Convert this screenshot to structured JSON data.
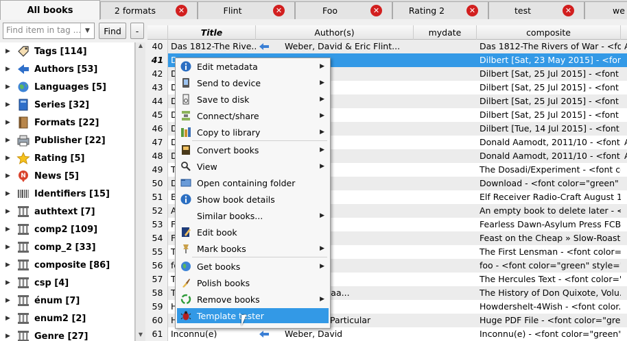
{
  "tabs": [
    {
      "label": "All books",
      "active": true,
      "closable": false
    },
    {
      "label": "2 formats",
      "active": false,
      "closable": true
    },
    {
      "label": "Flint",
      "active": false,
      "closable": true
    },
    {
      "label": "Foo",
      "active": false,
      "closable": true
    },
    {
      "label": "Rating 2",
      "active": false,
      "closable": true
    },
    {
      "label": "test",
      "active": false,
      "closable": true
    },
    {
      "label": "we",
      "active": false,
      "closable": false
    }
  ],
  "close_glyph": "✕",
  "search": {
    "placeholder": "Find item in tag ...",
    "find_label": "Find",
    "minus_label": "-"
  },
  "tree": [
    {
      "label": "Tags [114]",
      "icon": "tag-icon"
    },
    {
      "label": "Authors [53]",
      "icon": "author-arrow-icon"
    },
    {
      "label": "Languages [5]",
      "icon": "globe-icon"
    },
    {
      "label": "Series [32]",
      "icon": "series-icon"
    },
    {
      "label": "Formats [22]",
      "icon": "book-icon"
    },
    {
      "label": "Publisher [22]",
      "icon": "publisher-icon"
    },
    {
      "label": "Rating [5]",
      "icon": "star-icon"
    },
    {
      "label": "News [5]",
      "icon": "news-icon"
    },
    {
      "label": "Identifiers [15]",
      "icon": "barcode-icon"
    },
    {
      "label": "authtext [7]",
      "icon": "column-icon"
    },
    {
      "label": "comp2 [109]",
      "icon": "column-icon"
    },
    {
      "label": "comp_2 [33]",
      "icon": "column-icon"
    },
    {
      "label": "composite [86]",
      "icon": "column-icon"
    },
    {
      "label": "csp [4]",
      "icon": "column-icon"
    },
    {
      "label": "énum [7]",
      "icon": "column-icon"
    },
    {
      "label": "enum2 [2]",
      "icon": "column-icon"
    },
    {
      "label": "Genre [27]",
      "icon": "column-icon"
    }
  ],
  "columns": {
    "title": "Title",
    "authors": "Author(s)",
    "mydate": "mydate",
    "composite": "composite"
  },
  "rows": [
    {
      "num": "40",
      "title": "Das 1812-The Rive...",
      "arrow": true,
      "author": "Weber, David & Eric Flint...",
      "composite": "Das 1812-The Rivers of War - <font..",
      "extra": "A",
      "selected": false
    },
    {
      "num": "41",
      "title": "D",
      "arrow": false,
      "author": "",
      "composite": "Dilbert [Sat, 23 May 2015] - <font c...",
      "extra": "",
      "selected": true
    },
    {
      "num": "42",
      "title": "D",
      "arrow": false,
      "author": "",
      "composite": "Dilbert [Sat, 25 Jul 2015] - <font c...",
      "extra": "",
      "selected": false
    },
    {
      "num": "43",
      "title": "D",
      "arrow": false,
      "author": "",
      "composite": "Dilbert [Sat, 25 Jul 2015] - <font c...",
      "extra": "",
      "selected": false
    },
    {
      "num": "44",
      "title": "D",
      "arrow": false,
      "author": "",
      "composite": "Dilbert [Sat, 25 Jul 2015] - <font c...",
      "extra": "",
      "selected": false
    },
    {
      "num": "45",
      "title": "D",
      "arrow": false,
      "author": "",
      "composite": "Dilbert [Sat, 25 Jul 2015] - <font c...",
      "extra": "",
      "selected": false
    },
    {
      "num": "46",
      "title": "D",
      "arrow": false,
      "author": "",
      "composite": "Dilbert [Tue, 14 Jul 2015] - <font ...",
      "extra": "",
      "selected": false
    },
    {
      "num": "47",
      "title": "D",
      "arrow": false,
      "author": "MacArthur",
      "composite": "Donald Aamodt, 2011/10 - <font c...",
      "extra": "A",
      "selected": false
    },
    {
      "num": "48",
      "title": "D",
      "arrow": false,
      "author": "gh",
      "composite": "Donald Aamodt, 2011/10 - <font c...",
      "extra": "A",
      "selected": false
    },
    {
      "num": "49",
      "title": "T",
      "arrow": false,
      "author": "ert",
      "composite": "The Dosadi/Experiment - <font co...",
      "extra": "",
      "selected": false
    },
    {
      "num": "50",
      "title": "D",
      "arrow": false,
      "author": "",
      "composite": "Download - <font color=\"green\" s...",
      "extra": "",
      "selected": false
    },
    {
      "num": "51",
      "title": "E",
      "arrow": false,
      "author": "",
      "composite": "Elf Receiver Radio-Craft August 1...",
      "extra": "",
      "selected": false
    },
    {
      "num": "52",
      "title": "A",
      "arrow": false,
      "author": "or",
      "composite": "An empty book to delete later - <...",
      "extra": "",
      "selected": false
    },
    {
      "num": "53",
      "title": "F",
      "arrow": false,
      "author": "",
      "composite": "Fearless Dawn-Asylum Press FCB...",
      "extra": "",
      "selected": false
    },
    {
      "num": "54",
      "title": "F",
      "arrow": false,
      "author": "",
      "composite": "Feast on the Cheap » Slow-Roast...",
      "extra": "",
      "selected": false
    },
    {
      "num": "55",
      "title": "T",
      "arrow": false,
      "author": "r",
      "composite": "The First Lensman - <font color=...",
      "extra": "",
      "selected": false
    },
    {
      "num": "56",
      "title": "fo",
      "arrow": false,
      "author": "",
      "composite": "foo - <font color=\"green\" style=\"f...",
      "extra": "",
      "selected": false
    },
    {
      "num": "57",
      "title": "T",
      "arrow": false,
      "author": "tt",
      "composite": "The Hercules Text - <font color=\"...",
      "extra": "",
      "selected": false
    },
    {
      "num": "58",
      "title": "T",
      "arrow": false,
      "author": "ervantes Raa...",
      "composite": "The History of Don Quixote, Volu...",
      "extra": "",
      "selected": false
    },
    {
      "num": "59",
      "title": "H",
      "arrow": false,
      "author": "",
      "composite": "Howdershelt-4Wish - <font color...",
      "extra": "",
      "selected": false
    },
    {
      "num": "60",
      "title": "Huge PDF File",
      "arrow": false,
      "author": "No One In Particular",
      "composite": "Huge PDF File - <font color=\"gre...",
      "extra": "",
      "selected": false
    },
    {
      "num": "61",
      "title": "Inconnu(e)",
      "arrow": true,
      "author": "Weber, David",
      "composite": "Inconnu(e) - <font color=\"green\" s...",
      "extra": "",
      "selected": false
    }
  ],
  "menu": [
    {
      "label": "Edit metadata",
      "icon": "info-icon",
      "submenu": true
    },
    {
      "label": "Send to device",
      "icon": "device-icon",
      "submenu": true
    },
    {
      "label": "Save to disk",
      "icon": "save-icon",
      "submenu": true
    },
    {
      "label": "Connect/share",
      "icon": "connect-icon",
      "submenu": true
    },
    {
      "label": "Copy to library",
      "icon": "library-icon",
      "submenu": true
    },
    {
      "label": "Convert books",
      "icon": "convert-icon",
      "submenu": true,
      "sep_before": true
    },
    {
      "label": "View",
      "icon": "view-icon",
      "submenu": true
    },
    {
      "label": "Open containing folder",
      "icon": "folder-icon",
      "submenu": false
    },
    {
      "label": "Show book details",
      "icon": "details-icon",
      "submenu": false
    },
    {
      "label": "Similar books...",
      "icon": "",
      "submenu": true
    },
    {
      "label": "Edit book",
      "icon": "edit-book-icon",
      "submenu": false
    },
    {
      "label": "Mark books",
      "icon": "pin-icon",
      "submenu": true
    },
    {
      "label": "Get books",
      "icon": "globe-icon",
      "submenu": true,
      "sep_before": true
    },
    {
      "label": "Polish books",
      "icon": "brush-icon",
      "submenu": false
    },
    {
      "label": "Remove books",
      "icon": "recycle-icon",
      "submenu": true
    },
    {
      "label": "Template tester",
      "icon": "bug-icon",
      "submenu": false,
      "highlighted": true
    }
  ]
}
